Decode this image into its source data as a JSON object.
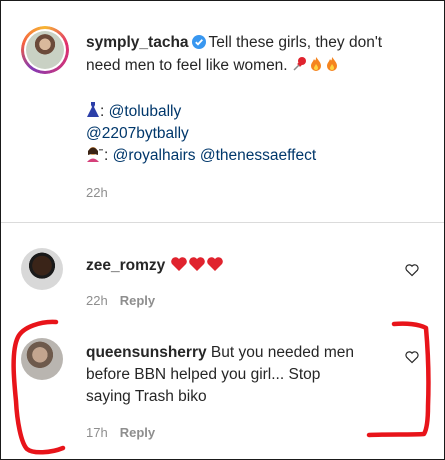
{
  "post": {
    "username": "symply_tacha",
    "caption_line1": "Tell these girls, they don't",
    "caption_line2": "need men to feel like women.",
    "dress_mention": "@tolubally",
    "second_mention": "@2207bytbally",
    "hair_mention_1": "@royalhairs",
    "hair_mention_2": "@thenessaeffect",
    "time": "22h"
  },
  "comments": [
    {
      "username": "zee_romzy",
      "text": "",
      "time": "22h",
      "reply_label": "Reply"
    },
    {
      "username": "queensunsherry",
      "text_line1": "But you needed men",
      "text_line2": "before BBN helped you girl... Stop",
      "text_line3": "saying Trash biko",
      "time": "17h",
      "reply_label": "Reply"
    }
  ],
  "colors": {
    "link": "#00376b",
    "verified": "#3897f0",
    "heart_emoji": "#e0232e",
    "annotation": "#e8141a"
  },
  "icons": [
    "verified-badge-icon",
    "pushpin-emoji",
    "fire-emoji",
    "dress-emoji",
    "haircut-emoji",
    "red-heart-emoji",
    "heart-outline-icon"
  ]
}
